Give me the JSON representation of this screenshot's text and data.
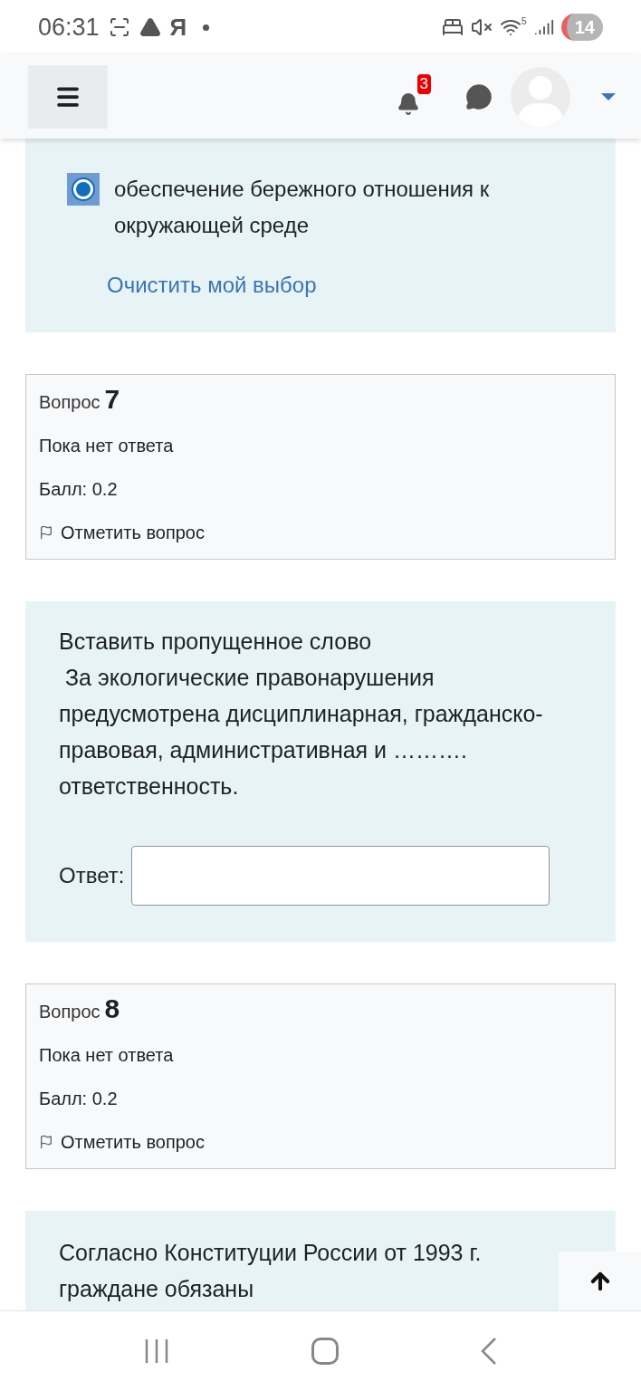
{
  "status_bar": {
    "time": "06:31",
    "app_letter": "Я",
    "wifi_band": "5",
    "battery": "14"
  },
  "header": {
    "notifications_count": "3"
  },
  "answer_card": {
    "options": [
      {
        "label": "обеспечение бережного отношения к окружающей среде",
        "selected": true
      }
    ],
    "clear_link": "Очистить мой выбор"
  },
  "questions": [
    {
      "info": {
        "label": "Вопрос",
        "number": "7",
        "status": "Пока нет ответа",
        "score": "Балл: 0.2",
        "flag": "Отметить вопрос"
      },
      "text": [
        "Вставить пропущенное слово",
        " За экологические правонарушения предусмотрена дисциплинарная, гражданско-правовая, административная и ………. ответственность."
      ],
      "answer_label": "Ответ:"
    },
    {
      "info": {
        "label": "Вопрос",
        "number": "8",
        "status": "Пока нет ответа",
        "score": "Балл: 0.2",
        "flag": "Отметить вопрос"
      },
      "text": [
        "Согласно Конституции России от 1993 г. граждане обязаны"
      ]
    }
  ]
}
